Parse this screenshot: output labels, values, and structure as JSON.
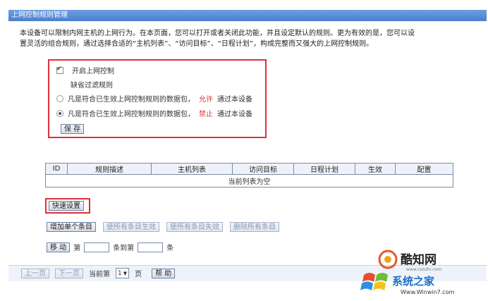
{
  "window": {
    "title": "上网控制规则管理"
  },
  "description": {
    "line1": "本设备可以限制内网主机的上网行为。在本页面，您可以打开或者关闭此功能，并且设定默认的规则。更为有效的是，您可以设",
    "line2": "置灵活的组合规则，通过选择合适的“主机列表”、“访问目标”、“日程计划”，构成完整而又强大的上网控制规则。"
  },
  "control": {
    "enable_label": "开启上网控制",
    "enable_checked": true,
    "default_rule_label": "缺省过滤规则",
    "option_allow": {
      "prefix": "凡是符合已生效上网控制规则的数据包，",
      "action": "允许",
      "suffix": "通过本设备",
      "selected": false
    },
    "option_deny": {
      "prefix": "凡是符合已生效上网控制规则的数据包，",
      "action": "禁止",
      "suffix": "通过本设备",
      "selected": true
    },
    "save_label": "保 存"
  },
  "table": {
    "columns": [
      "ID",
      "规则描述",
      "主机列表",
      "访问目标",
      "日程计划",
      "生效",
      "配置"
    ],
    "empty_text": "当前列表为空"
  },
  "actions": {
    "quick_setup": "快速设置",
    "add_entry": "增加单个条目",
    "enable_all": "使所有条目生效",
    "disable_all": "使所有条目失效",
    "delete_all": "删除所有条目",
    "move": "移 动",
    "move_prefix": "第",
    "move_middle": "条到第",
    "move_suffix": "条"
  },
  "pagination": {
    "prev": "上一页",
    "next": "下一页",
    "current_label": "当前第",
    "page": "1",
    "page_suffix": "页",
    "help": "帮 助"
  },
  "watermark": {
    "brand_top": "酷知网",
    "site_small": "www.coozhi.com",
    "brand_bottom": "系统之家",
    "url": "Www.Winwin7.com"
  }
}
